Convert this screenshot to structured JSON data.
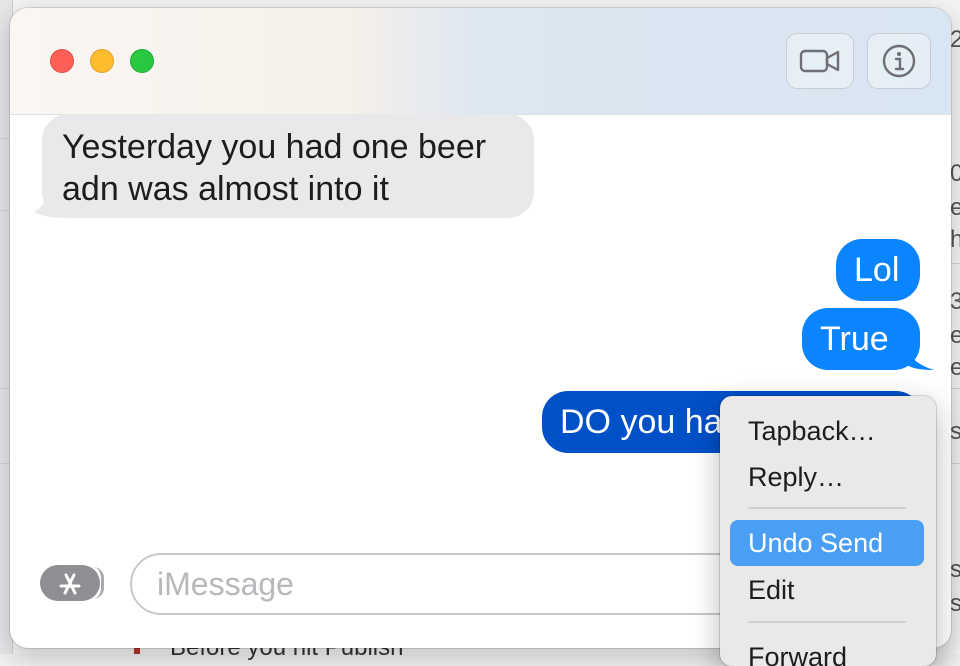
{
  "background": {
    "fragments": [
      "2",
      "0",
      "e,",
      "h",
      "3",
      "e",
      "e",
      "s",
      "s",
      "s"
    ],
    "bottom_text": "Before you hit Publish"
  },
  "window": {
    "traffic_lights": [
      "close",
      "minimize",
      "zoom"
    ],
    "toolbar": {
      "video_icon": "video-camera-icon",
      "info_icon": "info-circle-icon"
    }
  },
  "messages": [
    {
      "direction": "incoming",
      "line1": "Yesterday you had one beer",
      "line2": "adn was almost into it"
    },
    {
      "direction": "outgoing",
      "text": "Lol"
    },
    {
      "direction": "outgoing",
      "text": "True"
    },
    {
      "direction": "outgoing",
      "text": "DO you ha",
      "selected": true
    }
  ],
  "composer": {
    "apps_icon": "app-store-icon",
    "placeholder": "iMessage"
  },
  "context_menu": {
    "items": [
      {
        "label": "Tapback…"
      },
      {
        "label": "Reply…"
      },
      {
        "label": "Undo Send",
        "highlighted": true
      },
      {
        "label": "Edit"
      },
      {
        "label": "Forward"
      }
    ]
  },
  "colors": {
    "outgoing_bubble": "#0a84ff",
    "selected_bubble": "#0050c8",
    "incoming_bubble": "#e9e9eb",
    "menu_highlight": "#4a9ff5"
  }
}
